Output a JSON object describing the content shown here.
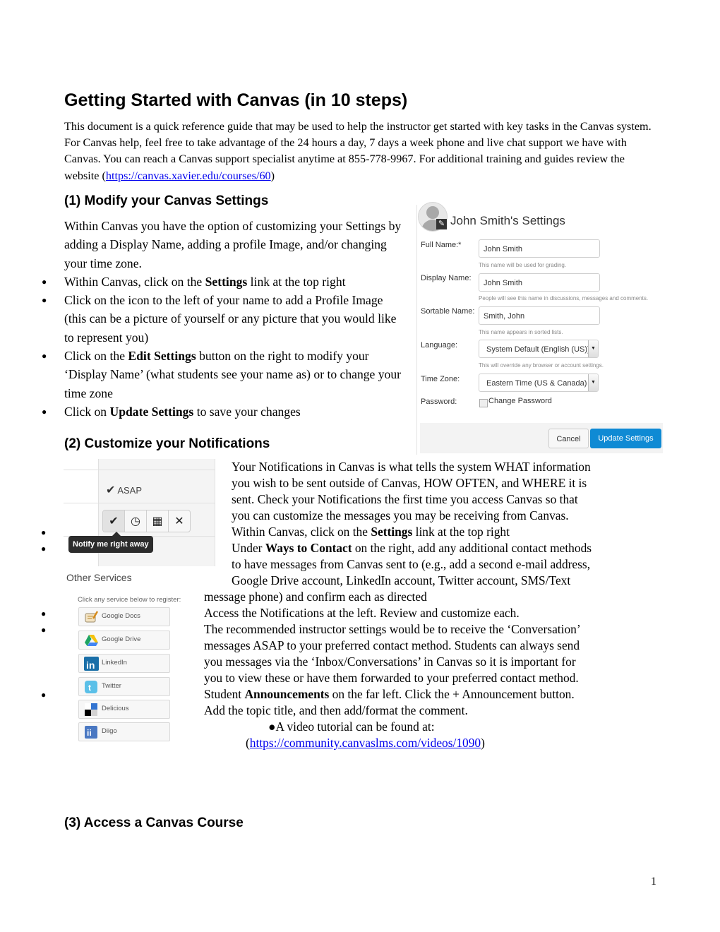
{
  "doc": {
    "title": "Getting Started with Canvas (in 10 steps)",
    "intro": {
      "text": "This document is a quick reference guide that may be used to help the instructor get started with key tasks in the Canvas system.  For Canvas help, feel free to take advantage of the 24 hours a day, 7 days a week phone and live chat support we have with Canvas. You can reach a Canvas support specialist anytime at 855-778-9967. For additional training and guides review the website (",
      "link": "https://canvas.xavier.edu/courses/60",
      "after": ")"
    },
    "page_number": "1"
  },
  "section1": {
    "heading": "(1) Modify your Canvas Settings",
    "paragraph": "Within Canvas you have the option of customizing your Settings by adding a Display Name, adding a profile Image, and/or changing your time zone.",
    "bullets": [
      {
        "pre": "Within Canvas, click on the ",
        "bold": "Settings",
        "post": " link at the top right"
      },
      {
        "pre": "Click on the icon to the left of your name to add a Profile Image (this can be a picture of yourself or any picture that you would like to represent you)",
        "bold": "",
        "post": ""
      },
      {
        "pre": "Click on the ",
        "bold": "Edit Settings",
        "post": " button on the right to modify your ‘Display Name’ (what students see your name as) or to change your time zone"
      },
      {
        "pre": "Click on ",
        "bold": "Update Settings",
        "post": " to save your changes"
      }
    ]
  },
  "settings_panel": {
    "title": "John Smith's Settings",
    "fields": [
      {
        "label": "Full Name:*",
        "value": "John Smith",
        "hint": "This name will be used for grading."
      },
      {
        "label": "Display Name:",
        "value": "John Smith",
        "hint": "People will see this name in discussions, messages and comments."
      },
      {
        "label": "Sortable Name:",
        "value": "Smith, John",
        "hint": "This name appears in sorted lists."
      },
      {
        "label": "Language:",
        "value": "System Default (English (US))",
        "hint": "This will override any browser or account settings."
      },
      {
        "label": "Time Zone:",
        "value": "Eastern Time (US & Canada)",
        "hint": ""
      }
    ],
    "password_label": "Password:",
    "change_password": "Change Password",
    "cancel": "Cancel",
    "update": "Update Settings",
    "accent": "#0f8ad4"
  },
  "section2": {
    "heading": "(2) Customize your Notifications",
    "lines": [
      "Your Notifications in Canvas is what tells the system WHAT information",
      "you wish to be sent outside of Canvas, HOW OFTEN, and WHERE it is",
      "sent.  Check your Notifications the first time you access Canvas so that",
      "you can customize the messages you may be receiving from Canvas."
    ],
    "b1": {
      "pre": "Within Canvas, click on the ",
      "bold": "Settings",
      "post": " link at the top right"
    },
    "b2": {
      "pre": "Under ",
      "bold": "Ways to Contact",
      "post": " on the right, add any additional contact methods",
      "l2": "to have messages from Canvas sent to (e.g., add a second e-mail address,",
      "l3": "Google Drive account, LinkedIn account,  Twitter account, SMS/Text",
      "l4": "message phone) and confirm each as directed"
    },
    "b3": "Access the Notifications at the left. Review and customize each.",
    "b4": [
      "The recommended instructor settings would be to receive the ‘Conversation’",
      "messages ASAP to your preferred contact method.  Students can always send",
      "you messages via the ‘Inbox/Conversations’  in Canvas so it is important for",
      "you to view these or have them forwarded to your preferred contact method."
    ],
    "b5": {
      "pre": "Student ",
      "bold": "Announcements",
      "post": " on the far left. Click the + Announcement button.",
      "l2": "Add the topic title, and then add/format the comment."
    },
    "video": {
      "label": "●A video tutorial can be found at:",
      "link": "https://community.canvaslms.com/videos/1090"
    }
  },
  "notif_panel": {
    "asap": "ASAP",
    "tooltip": "Notify me right away",
    "buttons": [
      "check-icon",
      "clock-icon",
      "calendar-icon",
      "close-icon"
    ]
  },
  "other_services": {
    "title": "Other Services",
    "hint": "Click any service below to register:",
    "services": [
      "Google Docs",
      "Google Drive",
      "LinkedIn",
      "Twitter",
      "Delicious",
      "Diigo"
    ]
  },
  "section3": {
    "heading": "(3) Access a Canvas Course"
  }
}
